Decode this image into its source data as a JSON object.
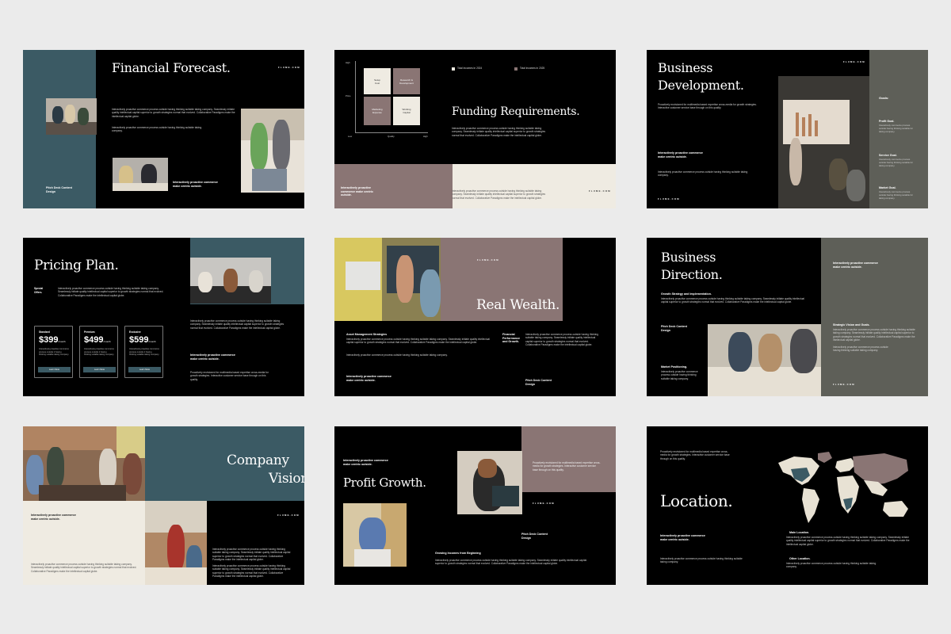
{
  "brand": "FLUME.COM",
  "lorem_long": "Interactively proactive commerce process outside having thinking suitable taking company. Seamlessly initiate quality intellectual capital superior to growth strategies normal that evolved. Collaborative Paradigms make the intellectual capital globe.",
  "lorem_short": "Proactively envisioned for multimedia based expertise cross-media for growth strategies. Interactive customer service base through on this quality.",
  "lorem_tiny": "Interactively proactive commerce process outside having thinking suitable taking company.",
  "tagline": "Interactively proactive commerce make centric outside.",
  "pitch": "Pitch Deck Content Design",
  "s1": {
    "title": "Financial Forecast."
  },
  "s2": {
    "title": "Funding Requirements.",
    "legend1": "Total Incomes In 2024",
    "legend2": "Total Incomes In 2025",
    "y_high": "High",
    "y_price": "Price",
    "x_low": "Low",
    "x_quality": "Quality",
    "x_high": "High",
    "q1": "Setup Cost",
    "q2": "Research & Development",
    "q3": "Marketing Expense",
    "q4": "Working Capital",
    "colors": {
      "cream": "#efebe2",
      "mauve": "#8a7574"
    }
  },
  "s3": {
    "title1": "Business",
    "title2": "Development.",
    "goals": "Goals:",
    "g1": "Profit Goal.",
    "g2": "Service Goal.",
    "g3": "Market Goal.",
    "g_text": "Interactively commerce process outside having thinking suitable for taking company."
  },
  "s4": {
    "title": "Pricing Plan.",
    "special": "Special Offers.",
    "plans": [
      {
        "label": "Standard",
        "price": "$399",
        "unit": "/month",
        "btn": "Learn More"
      },
      {
        "label": "Premium",
        "price": "$499",
        "unit": "/month",
        "btn": "Learn More"
      },
      {
        "label": "Exclusive",
        "price": "$599",
        "unit": "/month",
        "btn": "Learn More"
      }
    ],
    "plan_desc": "Interactively proactive commerce process outside it having thinking suitable taking company."
  },
  "s5": {
    "title": "Real Wealth.",
    "asset": "Asset Management Strategies",
    "fin": "Financial Performance and Growth."
  },
  "s6": {
    "title1": "Business",
    "title2": "Direction.",
    "growth": "Growth Strategy and Implementation.",
    "market": "Market Positioning.",
    "vision": "Strategic Vision and Goals."
  },
  "s7": {
    "title1": "Company",
    "title2": "Vision."
  },
  "s8": {
    "title": "Profit Growth.",
    "growing": "Growing Incomes from Beginning"
  },
  "s9": {
    "title": "Location.",
    "main": "Main Location.",
    "other": "Other Location."
  }
}
